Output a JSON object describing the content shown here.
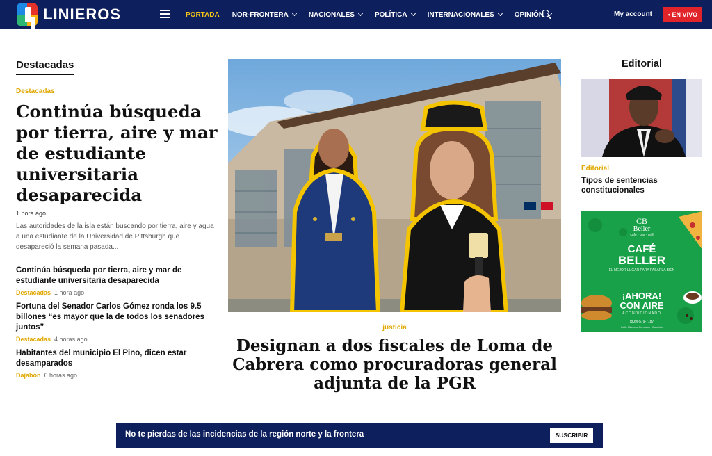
{
  "brand": {
    "name": "LINIEROS"
  },
  "nav": {
    "items": [
      {
        "label": "PORTADA",
        "active": true,
        "dropdown": false
      },
      {
        "label": "NOR-FRONTERA",
        "active": false,
        "dropdown": true
      },
      {
        "label": "NACIONALES",
        "active": false,
        "dropdown": true
      },
      {
        "label": "POLÍTICA",
        "active": false,
        "dropdown": true
      },
      {
        "label": "INTERNACIONALES",
        "active": false,
        "dropdown": true
      },
      {
        "label": "OPINIÓN",
        "active": false,
        "dropdown": true
      }
    ],
    "account_label": "My account",
    "live_label": "• EN VIVO"
  },
  "left": {
    "section_title": "Destacadas",
    "main": {
      "category": "Destacadas",
      "headline": "Continúa búsqueda por tierra, aire y mar de estudiante universitaria desaparecida",
      "time": "1 hora ago",
      "excerpt": "Las autoridades de la isla están buscando por tierra, aire y agua a una estudiante de la Universidad de Pittsburgh que desapareció la semana pasada..."
    },
    "list": [
      {
        "title": "Continúa búsqueda por tierra, aire y mar de estudiante universitaria desaparecida",
        "category": "Destacadas",
        "time": "1 hora ago"
      },
      {
        "title": "Fortuna del Senador Carlos Gómez ronda los 9.5 billones “es mayor que la de todos los senadores juntos”",
        "category": "Destacadas",
        "time": "4 horas ago"
      },
      {
        "title": "Habitantes del municipio El Pino, dicen estar desamparados",
        "category": "Dajabón",
        "time": "6 horas ago"
      }
    ]
  },
  "feature": {
    "category": "justicia",
    "headline": "Designan a dos fiscales de Loma de Cabrera como procuradoras general adjunta de la PGR"
  },
  "right": {
    "section_title": "Editorial",
    "article": {
      "category": "Editorial",
      "headline": "Tipos de sentencias constitucionales"
    },
    "ad": {
      "brand_top": "Beller",
      "brand_sub": "café · bar · grill",
      "headline1": "CAFÉ",
      "headline2": "BELLER",
      "tagline": "EL MEJOR LUGAR PARA PASARLA BIEN",
      "promo1": "¡AHORA!",
      "promo2": "CON AIRE",
      "promo3": "ACONDICIONADO",
      "phone": "(809)-579-7187",
      "address": "Calle Marcelo Carrasco · Dajabón"
    }
  },
  "newsletter": {
    "text": "No te pierdas de las incidencias de la región norte y la frontera",
    "button_label": "SUSCRIBIR"
  }
}
